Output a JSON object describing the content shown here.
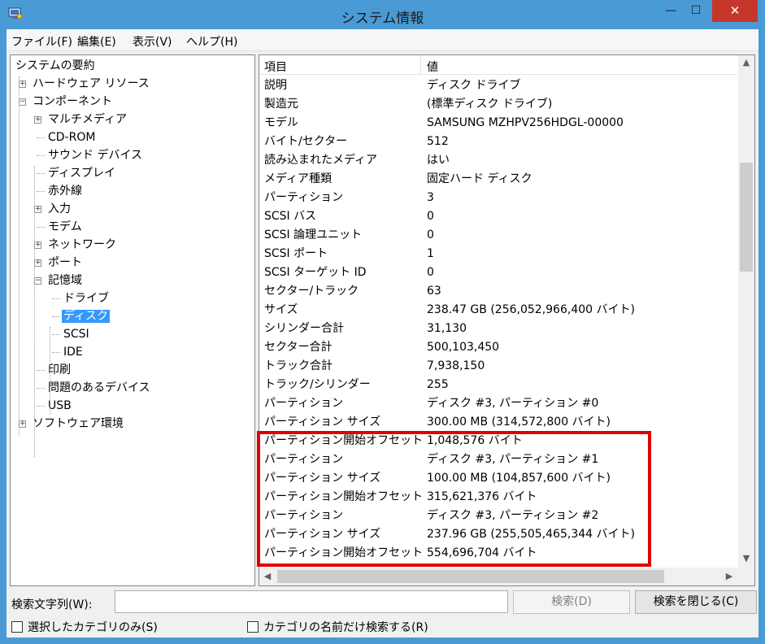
{
  "window": {
    "title": "システム情報",
    "controls": {
      "minimize": "—",
      "maximize": "☐",
      "close": "✕"
    }
  },
  "menu": [
    "ファイル(F)",
    "編集(E)",
    "表示(V)",
    "ヘルプ(H)"
  ],
  "tree": [
    {
      "label": "システムの要約",
      "depth": 0,
      "expander": ""
    },
    {
      "label": "ハードウェア リソース",
      "depth": 1,
      "expander": "+"
    },
    {
      "label": "コンポーネント",
      "depth": 1,
      "expander": "−"
    },
    {
      "label": "マルチメディア",
      "depth": 2,
      "expander": "+"
    },
    {
      "label": "CD-ROM",
      "depth": 2,
      "expander": ""
    },
    {
      "label": "サウンド デバイス",
      "depth": 2,
      "expander": ""
    },
    {
      "label": "ディスプレイ",
      "depth": 2,
      "expander": ""
    },
    {
      "label": "赤外線",
      "depth": 2,
      "expander": ""
    },
    {
      "label": "入力",
      "depth": 2,
      "expander": "+"
    },
    {
      "label": "モデム",
      "depth": 2,
      "expander": ""
    },
    {
      "label": "ネットワーク",
      "depth": 2,
      "expander": "+"
    },
    {
      "label": "ポート",
      "depth": 2,
      "expander": "+"
    },
    {
      "label": "記憶域",
      "depth": 2,
      "expander": "−"
    },
    {
      "label": "ドライブ",
      "depth": 3,
      "expander": ""
    },
    {
      "label": "ディスク",
      "depth": 3,
      "expander": "",
      "selected": true
    },
    {
      "label": "SCSI",
      "depth": 3,
      "expander": ""
    },
    {
      "label": "IDE",
      "depth": 3,
      "expander": ""
    },
    {
      "label": "印刷",
      "depth": 2,
      "expander": ""
    },
    {
      "label": "問題のあるデバイス",
      "depth": 2,
      "expander": ""
    },
    {
      "label": "USB",
      "depth": 2,
      "expander": ""
    },
    {
      "label": "ソフトウェア環境",
      "depth": 1,
      "expander": "+"
    }
  ],
  "details": {
    "headers": [
      "項目",
      "値"
    ],
    "rows": [
      [
        "説明",
        "ディスク ドライブ"
      ],
      [
        "製造元",
        "(標準ディスク ドライブ)"
      ],
      [
        "モデル",
        "SAMSUNG MZHPV256HDGL-00000"
      ],
      [
        "バイト/セクター",
        "512"
      ],
      [
        "読み込まれたメディア",
        "はい"
      ],
      [
        "メディア種類",
        "固定ハード ディスク"
      ],
      [
        "パーティション",
        "3"
      ],
      [
        "SCSI バス",
        "0"
      ],
      [
        "SCSI 論理ユニット",
        "0"
      ],
      [
        "SCSI ポート",
        "1"
      ],
      [
        "SCSI ターゲット ID",
        "0"
      ],
      [
        "セクター/トラック",
        "63"
      ],
      [
        "サイズ",
        "238.47 GB (256,052,966,400 バイト)"
      ],
      [
        "シリンダー合計",
        "31,130"
      ],
      [
        "セクター合計",
        "500,103,450"
      ],
      [
        "トラック合計",
        "7,938,150"
      ],
      [
        "トラック/シリンダー",
        "255"
      ],
      [
        "パーティション",
        "ディスク #3, パーティション #0"
      ],
      [
        "パーティション サイズ",
        "300.00 MB (314,572,800 バイト)"
      ],
      [
        "パーティション開始オフセット",
        "1,048,576 バイト"
      ],
      [
        "パーティション",
        "ディスク #3, パーティション #1"
      ],
      [
        "パーティション サイズ",
        "100.00 MB (104,857,600 バイト)"
      ],
      [
        "パーティション開始オフセット",
        "315,621,376 バイト"
      ],
      [
        "パーティション",
        "ディスク #3, パーティション #2"
      ],
      [
        "パーティション サイズ",
        "237.96 GB (255,505,465,344 バイト)"
      ],
      [
        "パーティション開始オフセット",
        "554,696,704 バイト"
      ]
    ]
  },
  "scrollbars": {
    "up": "▲",
    "down": "▼",
    "left": "◀",
    "right": "▶"
  },
  "search": {
    "label": "検索文字列(W):",
    "value": "",
    "search_button": "検索(D)",
    "close_button": "検索を閉じる(C)"
  },
  "checkboxes": {
    "selected_only": "選択したカテゴリのみ(S)",
    "names_only": "カテゴリの名前だけ検索する(R)"
  },
  "colors": {
    "titlebar": "#4a9ad6",
    "close_button": "#c7362b",
    "selection": "#3399ff",
    "highlight_box": "#e00000"
  }
}
